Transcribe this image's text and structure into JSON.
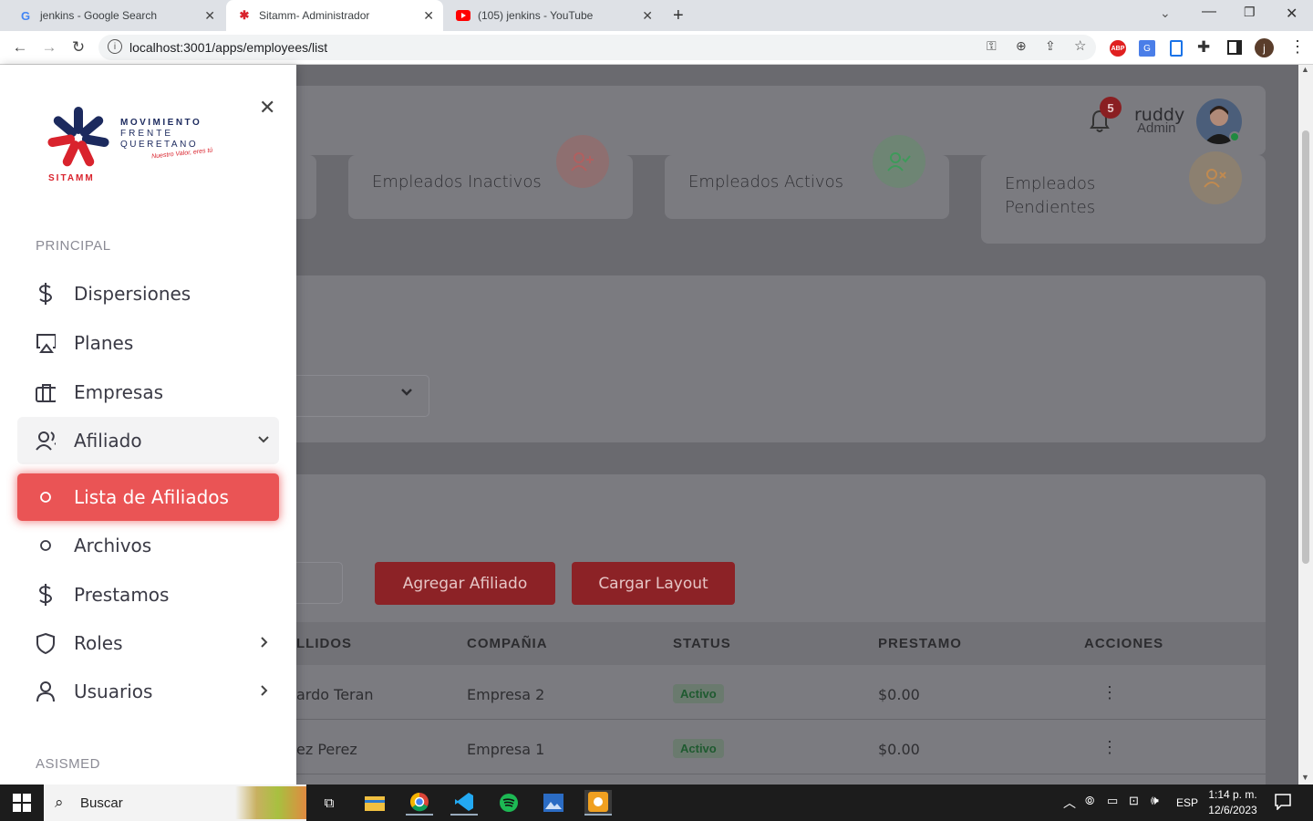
{
  "browser": {
    "tabs": [
      {
        "title": "jenkins - Google Search",
        "icon": "google-icon"
      },
      {
        "title": "Sitamm- Administrador",
        "icon": "sitamm-icon"
      },
      {
        "title": "(105) jenkins - YouTube",
        "icon": "youtube-icon"
      }
    ],
    "url": "localhost:3001/apps/employees/list",
    "profile_initial": "j"
  },
  "header": {
    "notifications_count": "5",
    "user_name": "ruddy",
    "user_role": "Admin"
  },
  "stats": [
    {
      "label": "Empleados Inactivos",
      "color": "#e06060"
    },
    {
      "label": "Empleados Activos",
      "color": "#38b060"
    },
    {
      "label": "Empleados Pendientes",
      "color": "#e0a060"
    }
  ],
  "actions": {
    "add_label": "Agregar Afiliado",
    "upload_label": "Cargar Layout"
  },
  "table": {
    "columns": [
      "LLIDOS",
      "COMPAÑIA",
      "STATUS",
      "PRESTAMO",
      "ACCIONES"
    ],
    "rows": [
      {
        "name": "ardo Teran",
        "company": "Empresa 2",
        "status": "Activo",
        "loan": "$0.00"
      },
      {
        "name": "ez Perez",
        "company": "Empresa 1",
        "status": "Activo",
        "loan": "$0.00"
      }
    ]
  },
  "sidebar": {
    "logo": {
      "line1": "MOVIMIENTO",
      "line2": "FRENTE",
      "line3": "QUERETANO",
      "tagline": "Nuestro Valor, eres tú",
      "brand": "SITAMM"
    },
    "section_principal": "PRINCIPAL",
    "section_asismed": "ASISMED",
    "items": [
      {
        "label": "Dispersiones",
        "icon": "dollar-icon"
      },
      {
        "label": "Planes",
        "icon": "airplay-icon"
      },
      {
        "label": "Empresas",
        "icon": "briefcase-icon"
      },
      {
        "label": "Afiliado",
        "icon": "users-icon"
      },
      {
        "label": "Lista de Afiliados",
        "icon": "circle-icon"
      },
      {
        "label": "Archivos",
        "icon": "circle-icon"
      },
      {
        "label": "Prestamos",
        "icon": "dollar-icon"
      },
      {
        "label": "Roles",
        "icon": "shield-icon"
      },
      {
        "label": "Usuarios",
        "icon": "user-icon"
      }
    ]
  },
  "taskbar": {
    "search_placeholder": "Buscar",
    "language": "ESP",
    "time": "1:14 p. m.",
    "date": "12/6/2023"
  }
}
